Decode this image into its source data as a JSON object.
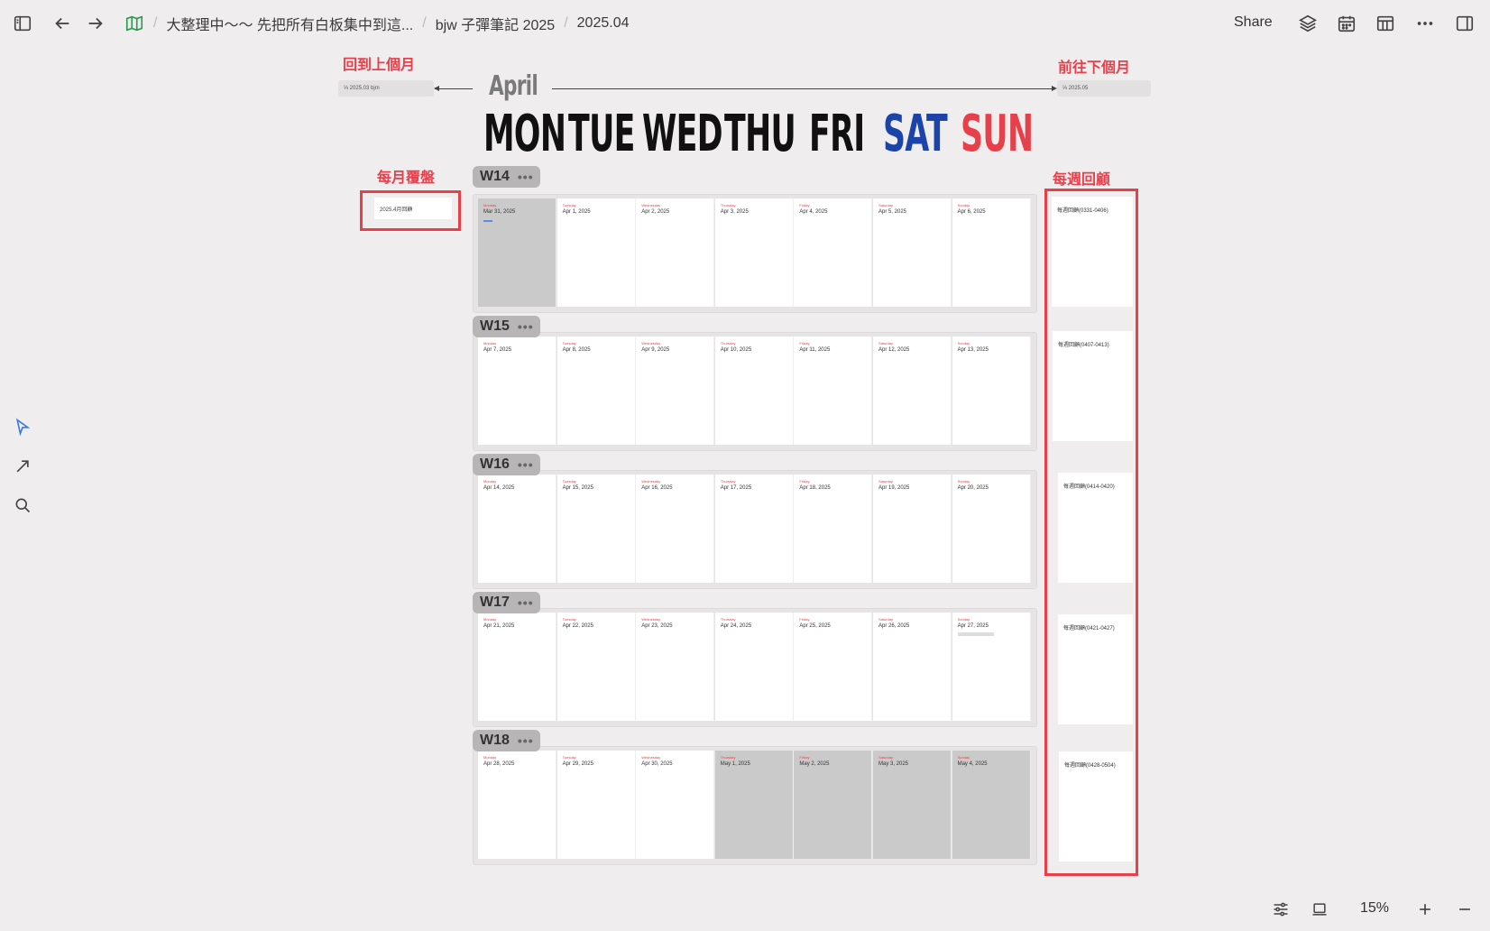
{
  "toolbar": {
    "breadcrumbs": [
      "大整理中～～ 先把所有白板集中到這...",
      "bjw 子彈筆記 2025",
      "2025.04"
    ],
    "share_label": "Share"
  },
  "canvas": {
    "prev_month_annotation": "回到上個月",
    "next_month_annotation": "前往下個月",
    "prev_month_card": "⅓ 2025.03 bjm",
    "next_month_card": "⅓ 2025.05",
    "month_title": "April",
    "day_headers": [
      "MON",
      "TUE",
      "WED",
      "THU",
      "FRI",
      "SAT",
      "SUN"
    ],
    "monthly_review_annotation": "每月覆盤",
    "monthly_review_card": "2025.4月回顧",
    "weekly_review_annotation": "每週回顧",
    "weekday_small": [
      "Monday",
      "Tuesday",
      "Wednesday",
      "Thursday",
      "Friday",
      "Saturday",
      "Sunday"
    ],
    "weeks": [
      {
        "label": "W14",
        "days": [
          "Mar 31, 2025",
          "Apr 1, 2025",
          "Apr 2, 2025",
          "Apr 3, 2025",
          "Apr 4, 2025",
          "Apr 5, 2025",
          "Apr 6, 2025"
        ],
        "gray": [
          true,
          false,
          false,
          false,
          false,
          false,
          false
        ],
        "review": "每週回顧(0331-0406)"
      },
      {
        "label": "W15",
        "days": [
          "Apr 7, 2025",
          "Apr 8, 2025",
          "Apr 9, 2025",
          "Apr 10, 2025",
          "Apr 11, 2025",
          "Apr 12, 2025",
          "Apr 13, 2025"
        ],
        "gray": [
          false,
          false,
          false,
          false,
          false,
          false,
          false
        ],
        "review": "每週回顧(0407-0413)"
      },
      {
        "label": "W16",
        "days": [
          "Apr 14, 2025",
          "Apr 15, 2025",
          "Apr 16, 2025",
          "Apr 17, 2025",
          "Apr 18, 2025",
          "Apr 19, 2025",
          "Apr 20, 2025"
        ],
        "gray": [
          false,
          false,
          false,
          false,
          false,
          false,
          false
        ],
        "review": "每週回顧(0414-0420)"
      },
      {
        "label": "W17",
        "days": [
          "Apr 21, 2025",
          "Apr 22, 2025",
          "Apr 23, 2025",
          "Apr 24, 2025",
          "Apr 25, 2025",
          "Apr 26, 2025",
          "Apr 27, 2025"
        ],
        "gray": [
          false,
          false,
          false,
          false,
          false,
          false,
          false
        ],
        "review": "每週回顧(0421-0427)"
      },
      {
        "label": "W18",
        "days": [
          "Apr 28, 2025",
          "Apr 29, 2025",
          "Apr 30, 2025",
          "May 1, 2025",
          "May 2, 2025",
          "May 3, 2025",
          "May 4, 2025"
        ],
        "gray": [
          false,
          false,
          false,
          true,
          true,
          true,
          true
        ],
        "review": "每週回顧(0428-0504)"
      }
    ]
  },
  "statusbar": {
    "zoom": "15%"
  },
  "colors": {
    "accent_red": "#e8404b",
    "sat_blue": "#1c44a8",
    "canvas_bg": "#efedee"
  }
}
